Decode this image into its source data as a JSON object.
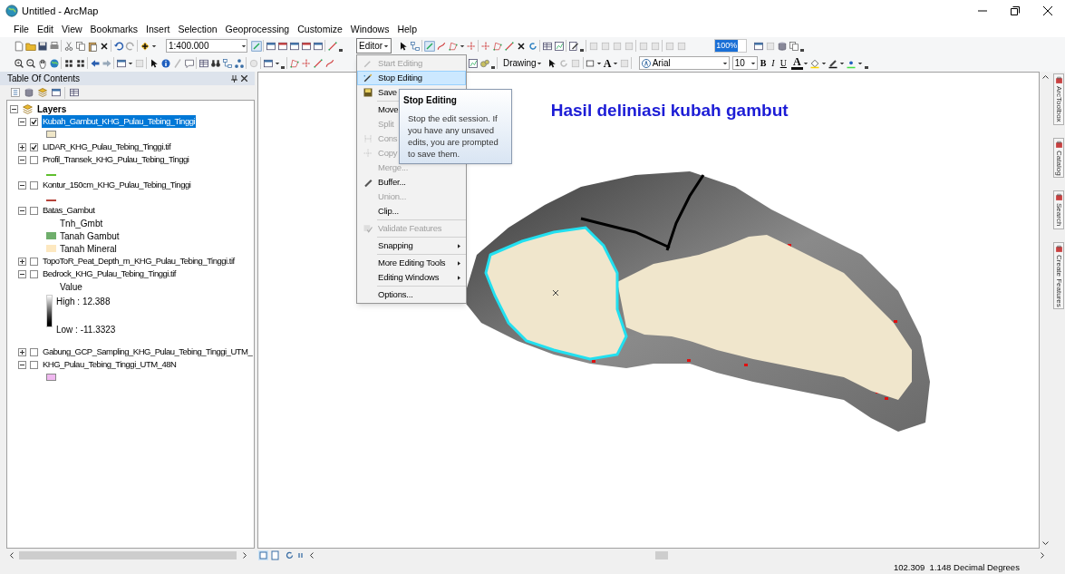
{
  "window": {
    "title": "Untitled - ArcMap"
  },
  "menu": [
    "File",
    "Edit",
    "View",
    "Bookmarks",
    "Insert",
    "Selection",
    "Geoprocessing",
    "Customize",
    "Windows",
    "Help"
  ],
  "toolbar": {
    "scale": "1:400.000",
    "editor": "Editor",
    "zoom": "100%",
    "drawing": "Drawing",
    "text_tool": "A",
    "font": "Arial",
    "font_size": "10",
    "bold": "B",
    "italic": "I",
    "underline": "U",
    "font_color": "A"
  },
  "toc": {
    "title": "Table Of Contents",
    "root": {
      "label": "Layers",
      "expanded": true,
      "children": [
        {
          "label": "Kubah_Gambut_KHG_Pulau_Tebing_Tinggi",
          "checked": true,
          "expanded": true,
          "selected": true,
          "legend": [
            {
              "kind": "swatch",
              "color": "#efe6c8"
            }
          ]
        },
        {
          "label": "LIDAR_KHG_Pulau_Tebing_Tinggi.tif",
          "checked": true,
          "expanded": false,
          "selected": false
        },
        {
          "label": "Profil_Transek_KHG_Pulau_Tebing_Tinggi",
          "checked": false,
          "expanded": true,
          "selected": false,
          "legend": [
            {
              "kind": "line",
              "color": "#5fbf2f"
            }
          ]
        },
        {
          "label": "Kontur_150cm_KHG_Pulau_Tebing_Tinggi",
          "checked": false,
          "expanded": true,
          "selected": false,
          "legend": [
            {
              "kind": "line",
              "color": "#b5433a"
            }
          ]
        },
        {
          "label": "Batas_Gambut",
          "checked": false,
          "expanded": true,
          "selected": false,
          "legend": [
            {
              "kind": "heading",
              "label": "Tnh_Gmbt"
            },
            {
              "kind": "swatch",
              "color": "#6fae6c",
              "label": "Tanah Gambut"
            },
            {
              "kind": "swatch",
              "color": "#fde8c0",
              "label": "Tanah Mineral"
            }
          ]
        },
        {
          "label": "TopoToR_Peat_Depth_m_KHG_Pulau_Tebing_Tinggi.tif",
          "checked": false,
          "expanded": false,
          "selected": false
        },
        {
          "label": "Bedrock_KHG_Pulau_Tebing_Tinggi.tif",
          "checked": false,
          "expanded": true,
          "selected": false,
          "legend": [
            {
              "kind": "heading",
              "label": "Value"
            },
            {
              "kind": "ramp",
              "high": "High : 12.388",
              "low": "Low : -11.3323"
            }
          ]
        },
        {
          "label": "Gabung_GCP_Sampling_KHG_Pulau_Tebing_Tinggi_UTM_",
          "checked": false,
          "expanded": false,
          "selected": false
        },
        {
          "label": "KHG_Pulau_Tebing_Tinggi_UTM_48N",
          "checked": false,
          "expanded": true,
          "selected": false,
          "legend": [
            {
              "kind": "swatch",
              "color": "#f0b8f0"
            }
          ]
        }
      ]
    }
  },
  "editor_menu": [
    [
      {
        "label": "Start Editing",
        "disabled": true,
        "selected": false,
        "submenu": false,
        "icon": true
      },
      {
        "label": "Stop Editing",
        "disabled": false,
        "selected": true,
        "submenu": false,
        "icon": true
      },
      {
        "label": "Save",
        "disabled": false,
        "selected": false,
        "icon": true
      }
    ],
    [
      {
        "label": "Move",
        "disabled": false,
        "selected": false,
        "icon": false
      },
      {
        "label": "Split",
        "disabled": true,
        "selected": false,
        "icon": false
      },
      {
        "label": "Cons",
        "disabled": true,
        "selected": false,
        "icon": true
      },
      {
        "label": "Copy",
        "disabled": true,
        "selected": false,
        "icon": true
      },
      {
        "label": "Merge...",
        "disabled": true,
        "selected": false,
        "submenu": false,
        "icon": false
      },
      {
        "label": "Buffer...",
        "disabled": false,
        "selected": false,
        "submenu": false,
        "icon": true
      },
      {
        "label": "Union...",
        "disabled": true,
        "selected": false,
        "submenu": false,
        "icon": false
      },
      {
        "label": "Clip...",
        "disabled": false,
        "selected": false,
        "submenu": false,
        "icon": false
      }
    ],
    [
      {
        "label": "Validate Features",
        "disabled": true,
        "selected": false,
        "submenu": false,
        "icon": true
      }
    ],
    [
      {
        "label": "Snapping",
        "disabled": false,
        "selected": false,
        "submenu": true,
        "icon": false
      }
    ],
    [
      {
        "label": "More Editing Tools",
        "disabled": false,
        "selected": false,
        "submenu": true,
        "icon": false
      },
      {
        "label": "Editing Windows",
        "disabled": false,
        "selected": false,
        "submenu": true,
        "icon": false
      }
    ],
    [
      {
        "label": "Options...",
        "disabled": false,
        "selected": false,
        "submenu": false,
        "icon": false
      }
    ]
  ],
  "tooltip": {
    "title": "Stop Editing",
    "text": "Stop the edit session. If you have any unsaved edits, you are prompted to save them."
  },
  "map": {
    "title": "Hasil deliniasi kubah gambut"
  },
  "dock_tabs": [
    "ArcToolbox",
    "Catalog",
    "Search",
    "Create Features"
  ],
  "status_bar": {
    "coordinates": "102.309  1.148 Decimal Degrees"
  }
}
